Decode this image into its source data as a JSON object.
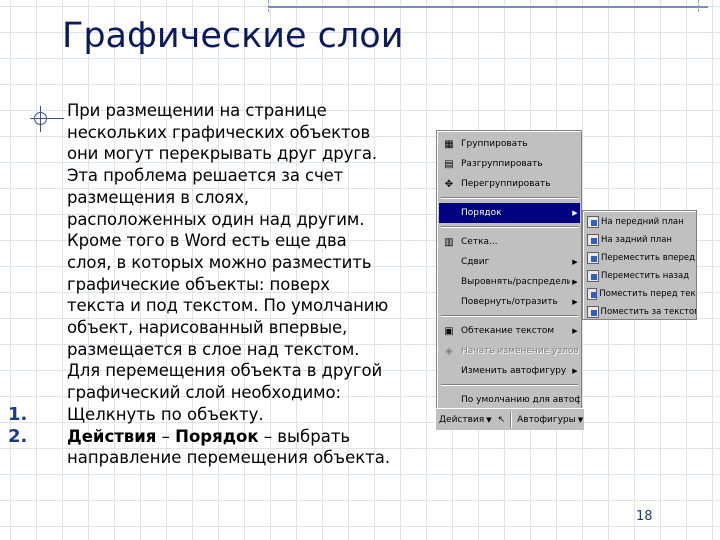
{
  "slide": {
    "title": "Графические слои",
    "page_number": "18"
  },
  "body_lines": [
    "При размещении на странице",
    "нескольких графических объектов",
    "они могут перекрывать друг друга.",
    "Эта проблема решается за счет",
    "размещения в слоях,",
    "расположенных один над другим.",
    "Кроме того в Word есть еще два",
    "слоя, в которых можно разместить",
    "графические объекты: поверх",
    "текста и под текстом. По умолчанию",
    "объект, нарисованный впервые,",
    "размещается в слое над текстом.",
    "Для перемещения объекта в другой",
    "графический слой необходимо:"
  ],
  "steps": [
    {
      "num": "1.",
      "text": "Щелкнуть по объекту."
    },
    {
      "num": "2.",
      "bold1": "Действия",
      "sep1": " – ",
      "bold2": "Порядок",
      "sep2": " – выбрать",
      "cont": "направление перемещения объекта."
    }
  ],
  "menu": {
    "items": [
      {
        "label": "Группировать",
        "icon": "group-icon",
        "disabled": false
      },
      {
        "label": "Разгруппировать",
        "icon": "ungroup-icon",
        "disabled": false
      },
      {
        "label": "Перегруппировать",
        "icon": "regroup-icon",
        "disabled": false
      },
      {
        "label": "Порядок",
        "icon": "",
        "disabled": false,
        "highlighted": true,
        "submenu": true
      },
      {
        "label": "Сетка...",
        "icon": "grid-icon",
        "disabled": false
      },
      {
        "label": "Сдвиг",
        "icon": "",
        "disabled": false,
        "submenu": true
      },
      {
        "label": "Выровнять/распределить",
        "icon": "",
        "disabled": false,
        "submenu": true
      },
      {
        "label": "Повернуть/отразить",
        "icon": "",
        "disabled": false,
        "submenu": true
      },
      {
        "label": "Обтекание текстом",
        "icon": "wrap-icon",
        "disabled": false,
        "submenu": true
      },
      {
        "label": "Начать изменение узлов",
        "icon": "nodes-icon",
        "disabled": true
      },
      {
        "label": "Изменить автофигуру",
        "icon": "",
        "disabled": false,
        "submenu": true
      },
      {
        "label": "По умолчанию для автофигур",
        "icon": "",
        "disabled": false
      }
    ],
    "toolbar": {
      "actions_label": "Действия",
      "autoshapes_label": "Автофигуры"
    }
  },
  "submenu": {
    "items": [
      "На передний план",
      "На задний план",
      "Переместить вперед",
      "Переместить назад",
      "Поместить перед текстом",
      "Поместить за текстом"
    ]
  },
  "colors": {
    "title": "#0a1a5c",
    "accent": "#1c3a8a",
    "menu_highlight": "#000080",
    "menu_bg": "#c0c0c0"
  }
}
